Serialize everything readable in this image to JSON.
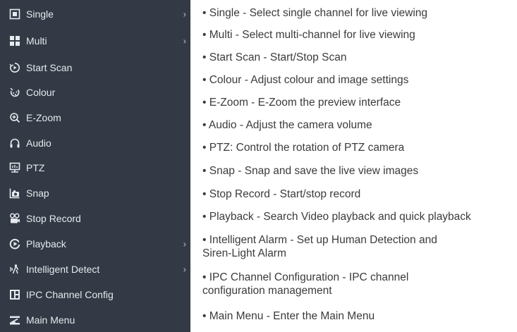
{
  "menu": {
    "items": [
      {
        "label": "Single",
        "icon": "single-view-icon",
        "has_submenu": true
      },
      {
        "label": "Multi",
        "icon": "multi-view-icon",
        "has_submenu": true
      },
      {
        "label": "Start Scan",
        "icon": "scan-icon",
        "has_submenu": false
      },
      {
        "label": "Colour",
        "icon": "colour-icon",
        "has_submenu": false
      },
      {
        "label": "E-Zoom",
        "icon": "zoom-icon",
        "has_submenu": false
      },
      {
        "label": "Audio",
        "icon": "headphones-icon",
        "has_submenu": false
      },
      {
        "label": "PTZ",
        "icon": "ptz-icon",
        "has_submenu": false
      },
      {
        "label": "Snap",
        "icon": "snap-icon",
        "has_submenu": false
      },
      {
        "label": "Stop Record",
        "icon": "record-icon",
        "has_submenu": false
      },
      {
        "label": "Playback",
        "icon": "playback-icon",
        "has_submenu": true
      },
      {
        "label": "Intelligent Detect",
        "icon": "detect-icon",
        "has_submenu": true
      },
      {
        "label": "IPC Channel Config",
        "icon": "ipc-config-icon",
        "has_submenu": false
      },
      {
        "label": "Main Menu",
        "icon": "main-menu-icon",
        "has_submenu": false
      }
    ],
    "chevron": "›"
  },
  "descriptions": [
    {
      "line1": "• Single - Select single channel for live viewing"
    },
    {
      "line1": "• Multi - Select multi-channel for live viewing"
    },
    {
      "line1": "• Start Scan - Start/Stop Scan"
    },
    {
      "line1": "• Colour - Adjust colour and image settings"
    },
    {
      "line1": "• E-Zoom - E-Zoom the preview interface"
    },
    {
      "line1": "• Audio - Adjust the camera volume"
    },
    {
      "line1": "• PTZ: Control the rotation of PTZ camera"
    },
    {
      "line1": "• Snap - Snap and save the live view images"
    },
    {
      "line1": "• Stop Record - Start/stop record"
    },
    {
      "line1": "• Playback - Search Video playback and quick playback"
    },
    {
      "line1": "• Intelligent Alarm - Set up Human Detection and",
      "line2": "Siren-Light Alarm"
    },
    {
      "line1": "• IPC Channel Configuration - IPC channel",
      "line2": "configuration management"
    },
    {
      "line1": "• Main Menu - Enter the Main Menu"
    }
  ],
  "colors": {
    "menu_bg": "#333a45",
    "menu_text": "#e6e9ee",
    "desc_text": "#3b3b3b"
  }
}
